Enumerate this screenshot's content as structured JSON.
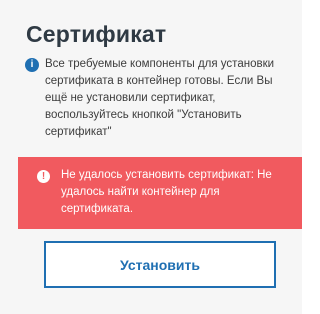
{
  "page": {
    "title": "Сертификат",
    "info": {
      "icon": "info-icon",
      "text": "Все требуемые компоненты для установки сертификата в контейнер готовы. Если Вы ещё не установили сертификат, воспользуйтесь кнопкой \"Установить сертификат\""
    },
    "error": {
      "icon": "exclamation-icon",
      "text": "Не удалось установить сертификат: Не удалось найти контейнер для сертификата."
    },
    "install_button_label": "Установить"
  },
  "colors": {
    "panel_bg": "#f6f6f6",
    "title": "#2f3a44",
    "info_icon": "#1f6fb2",
    "error_bg": "#f15a5f",
    "accent": "#1f6fb2"
  }
}
